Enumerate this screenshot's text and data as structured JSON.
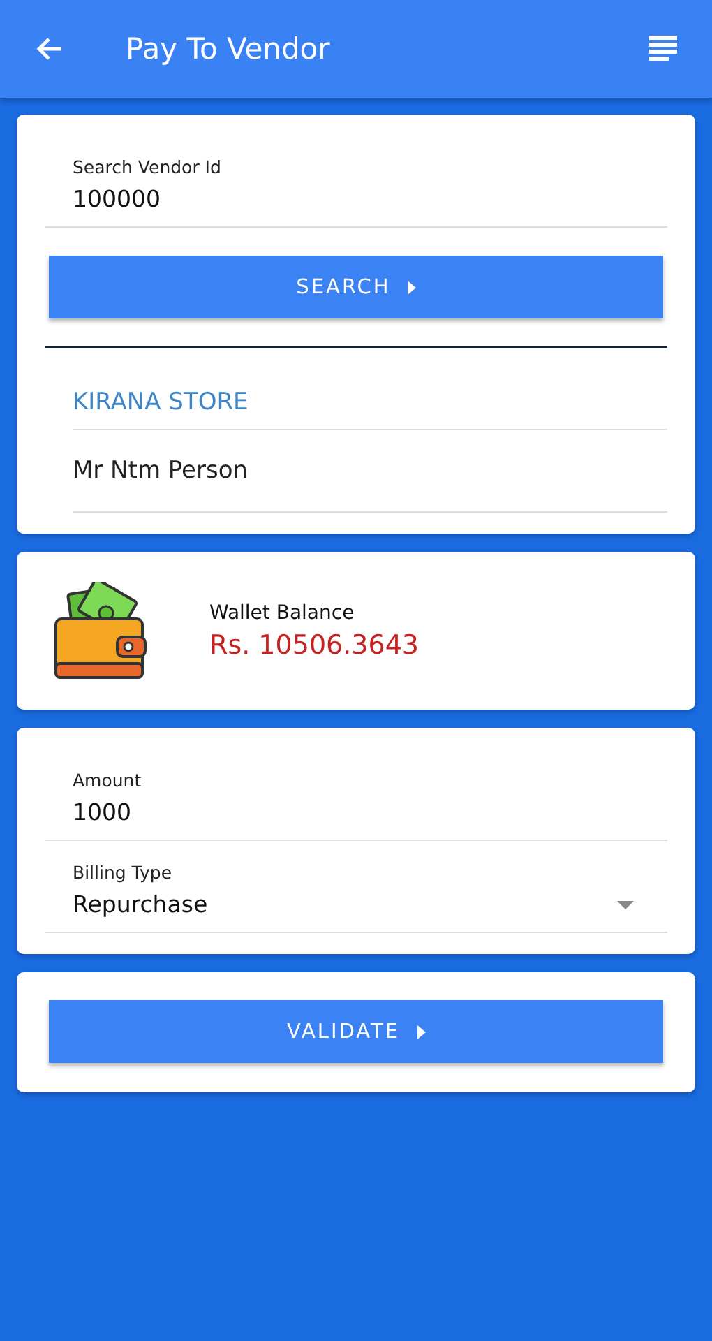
{
  "app_bar": {
    "title": "Pay To Vendor"
  },
  "vendor_search": {
    "field": {
      "label": "Search Vendor Id",
      "value": "100000"
    },
    "button": "SEARCH"
  },
  "vendor": {
    "store_name": "KIRANA STORE",
    "person_name": "Mr Ntm Person"
  },
  "wallet": {
    "label": "Wallet Balance",
    "balance": "Rs. 10506.3643"
  },
  "payment": {
    "amount": {
      "label": "Amount",
      "value": "1000"
    },
    "billing_type": {
      "label": "Billing Type",
      "value": "Repurchase"
    }
  },
  "validate_button": "VALIDATE"
}
